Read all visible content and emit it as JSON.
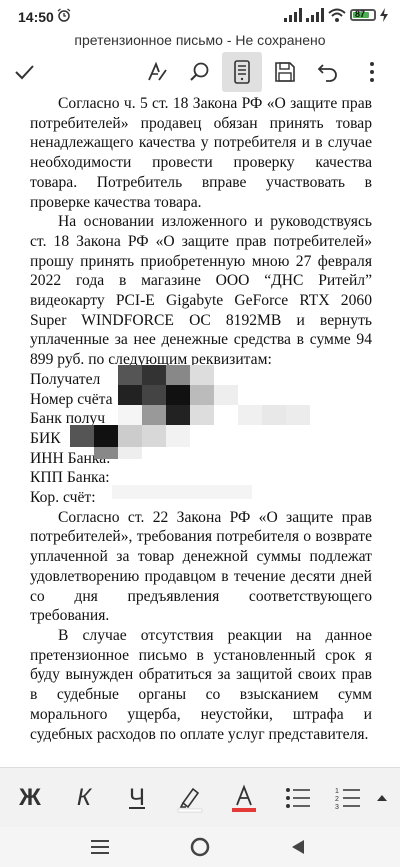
{
  "status": {
    "time": "14:50",
    "battery": "87"
  },
  "title": "претензионное письмо - Не сохранено",
  "toolbar": {
    "icons": [
      "check-icon",
      "draw-icon",
      "search-icon",
      "reading-mode-icon",
      "save-icon",
      "undo-icon",
      "more-icon"
    ]
  },
  "document": {
    "para1": "Согласно ч. 5 ст. 18 Закона РФ «О защите прав потребителей» продавец обязан принять товар ненадлежащего качества у потребителя и в случае необходимости провести проверку качества товара. Потребитель вправе участвовать в проверке качества товара.",
    "para2": "На основании изложенного и руководствуясь ст. 18 Закона РФ «О защите прав потребителей» прошу принять приобретенную мною 27 февраля 2022 года в магазине ООО “ДНС Ритейл” видеокарту PCI-E Gigabyte GeForce RTX 2060 Super WINDFORCE OC 8192MB и вернуть уплаченные за нее денежные средства в сумме 94 899 руб. по следующим реквизитам:",
    "fields": [
      "Получател",
      "Номер счёта",
      "Банк получ",
      "БИК",
      "ИНН Банка:",
      "КПП Банка:",
      "Кор. счёт:"
    ],
    "para3": "Согласно ст. 22 Закона РФ «О защите прав потребителей», требования потребителя о возврате уплаченной за товар денежной суммы подлежат удовлетворению продавцом в течение десяти дней со дня предъявления соответствующего требования.",
    "para4": "В случае отсутствия реакции на данное претензионное письмо в установленный срок я буду вынужден обратиться за защитой своих прав в судебные органы со взысканием сумм морального ущерба, неустойки, штрафа и судебных расходов по оплате услуг представителя."
  },
  "format_toolbar": {
    "bold": "Ж",
    "italic": "К",
    "underline": "Ч"
  },
  "colors": {
    "font_color_underline": "#e53935",
    "highlight_underline": "#ffffff",
    "battery_fill": "#4caf50"
  }
}
